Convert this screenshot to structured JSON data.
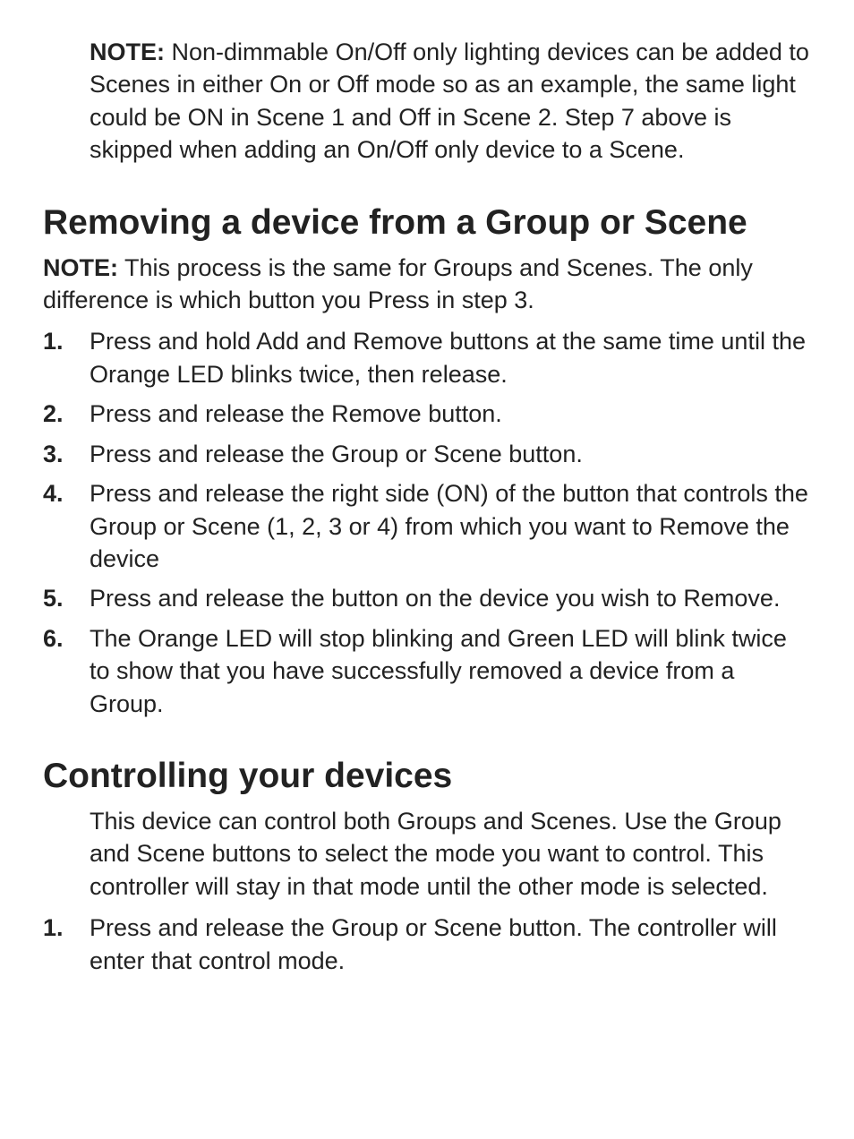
{
  "topNote": {
    "label": "NOTE:",
    "text": " Non-dimmable On/Off only lighting devices can be added to Scenes in either On or Off mode so as an example, the same light could be ON in Scene 1 and Off in Scene 2.  Step 7 above is skipped when adding an On/Off only device to a Scene."
  },
  "section1": {
    "heading": "Removing a device from a Group or Scene",
    "note": {
      "label": "NOTE:",
      "text": " This process is the same for Groups and Scenes.  The only difference is which button you Press in step 3."
    },
    "steps": [
      {
        "num": "1.",
        "text": "Press and hold Add and Remove buttons at the same time until the Orange LED blinks twice, then release."
      },
      {
        "num": "2.",
        "text": "Press and release the Remove button."
      },
      {
        "num": "3.",
        "text": "Press and release the Group or Scene button."
      },
      {
        "num": "4.",
        "text": "Press and release the right side (ON) of the button that controls the Group or Scene (1, 2, 3 or 4) from which you want to Remove the device"
      },
      {
        "num": "5.",
        "text": "Press and release the button on the device you wish to Remove."
      },
      {
        "num": "6.",
        "text": "The Orange LED will stop blinking and Green LED will blink twice to show that you have successfully removed a device from a Group."
      }
    ]
  },
  "section2": {
    "heading": "Controlling your devices",
    "intro": "This device can control both Groups and Scenes. Use the Group and Scene buttons to select the mode you want to control. This controller will stay in that mode until the other mode is selected.",
    "steps": [
      {
        "num": "1.",
        "text": "Press and release the Group or Scene button.  The controller will enter that control mode."
      }
    ]
  }
}
